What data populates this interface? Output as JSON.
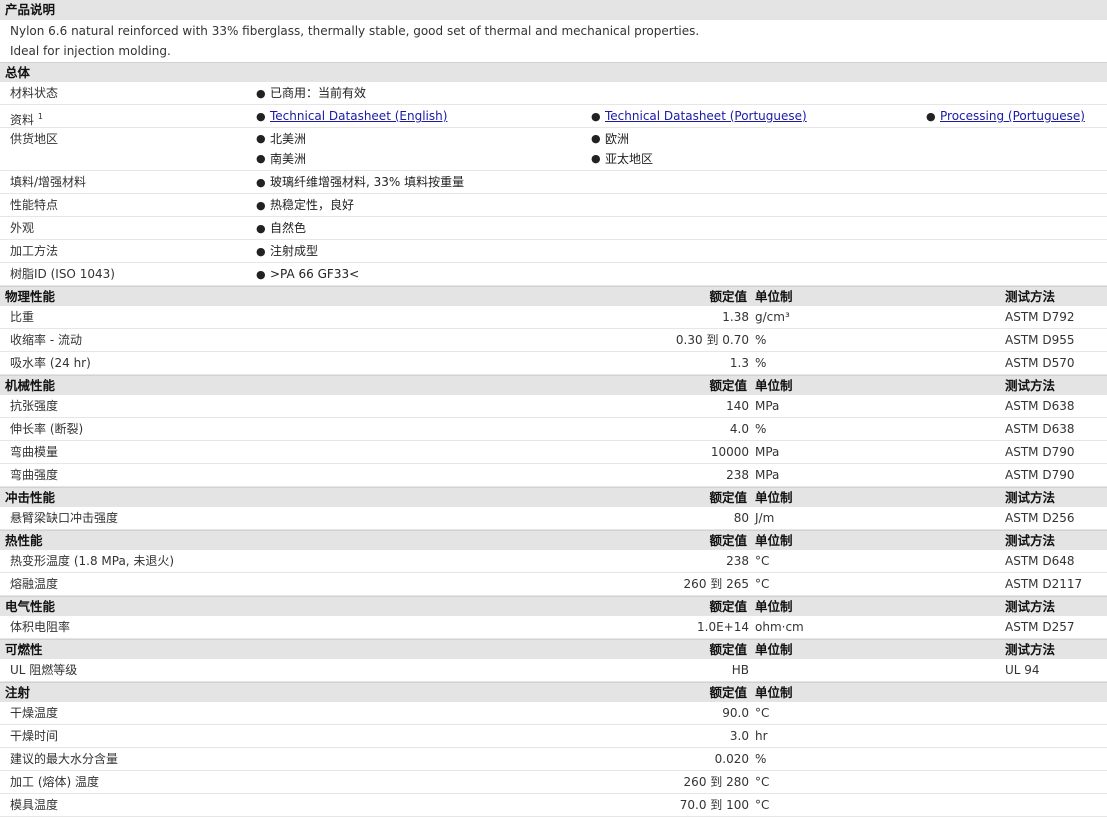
{
  "desc": {
    "title": "产品说明",
    "line1": "Nylon 6.6 natural reinforced with 33% fiberglass, thermally stable, good set of thermal and mechanical properties.",
    "line2": "Ideal for injection molding."
  },
  "general": {
    "title": "总体",
    "status_label": "材料状态",
    "status_value": "已商用：当前有效",
    "docs_label": "资料",
    "docs_sup": "1",
    "doc1": "Technical Datasheet (English)",
    "doc2": "Technical Datasheet (Portuguese)",
    "doc3": "Processing (Portuguese)",
    "region_label": "供货地区",
    "region1": "北美洲",
    "region2": "欧洲",
    "region3": "南美洲",
    "region4": "亚太地区",
    "filler_label": "填料/增强材料",
    "filler_value": "玻璃纤维增强材料, 33% 填料按重量",
    "features_label": "性能特点",
    "features_value": "热稳定性，良好",
    "appearance_label": "外观",
    "appearance_value": "自然色",
    "process_label": "加工方法",
    "process_value": "注射成型",
    "resin_label": "树脂ID (ISO 1043)",
    "resin_value": ">PA 66 GF33<"
  },
  "hdr": {
    "value": "额定值",
    "unit": "单位制",
    "method": "测试方法"
  },
  "physical": {
    "title": "物理性能",
    "rows": [
      {
        "label": "比重",
        "value": "1.38",
        "unit": "g/cm³",
        "method": "ASTM D792"
      },
      {
        "label": "收缩率 - 流动",
        "value": "0.30 到 0.70",
        "unit": "%",
        "method": "ASTM D955"
      },
      {
        "label": "吸水率 (24 hr)",
        "value": "1.3",
        "unit": "%",
        "method": "ASTM D570"
      }
    ]
  },
  "mechanical": {
    "title": "机械性能",
    "rows": [
      {
        "label": "抗张强度",
        "value": "140",
        "unit": "MPa",
        "method": "ASTM D638"
      },
      {
        "label": "伸长率 (断裂)",
        "value": "4.0",
        "unit": "%",
        "method": "ASTM D638"
      },
      {
        "label": "弯曲模量",
        "value": "10000",
        "unit": "MPa",
        "method": "ASTM D790"
      },
      {
        "label": "弯曲强度",
        "value": "238",
        "unit": "MPa",
        "method": "ASTM D790"
      }
    ]
  },
  "impact": {
    "title": "冲击性能",
    "rows": [
      {
        "label": "悬臂梁缺口冲击强度",
        "value": "80",
        "unit": "J/m",
        "method": "ASTM D256"
      }
    ]
  },
  "thermal": {
    "title": "热性能",
    "rows": [
      {
        "label": "热变形温度 (1.8 MPa, 未退火)",
        "value": "238",
        "unit": "°C",
        "method": "ASTM D648"
      },
      {
        "label": "熔融温度",
        "value": "260 到 265",
        "unit": "°C",
        "method": "ASTM D2117"
      }
    ]
  },
  "electrical": {
    "title": "电气性能",
    "rows": [
      {
        "label": "体积电阻率",
        "value": "1.0E+14",
        "unit": "ohm·cm",
        "method": "ASTM D257"
      }
    ]
  },
  "flammability": {
    "title": "可燃性",
    "rows": [
      {
        "label": "UL 阻燃等级",
        "value": "HB",
        "unit": "",
        "method": "UL 94"
      }
    ]
  },
  "injection": {
    "title": "注射",
    "rows": [
      {
        "label": "干燥温度",
        "value": "90.0",
        "unit": "°C",
        "method": ""
      },
      {
        "label": "干燥时间",
        "value": "3.0",
        "unit": "hr",
        "method": ""
      },
      {
        "label": "建议的最大水分含量",
        "value": "0.020",
        "unit": "%",
        "method": ""
      },
      {
        "label": "加工 (熔体) 温度",
        "value": "260 到 280",
        "unit": "°C",
        "method": ""
      },
      {
        "label": "模具温度",
        "value": "70.0 到 100",
        "unit": "°C",
        "method": ""
      }
    ]
  }
}
